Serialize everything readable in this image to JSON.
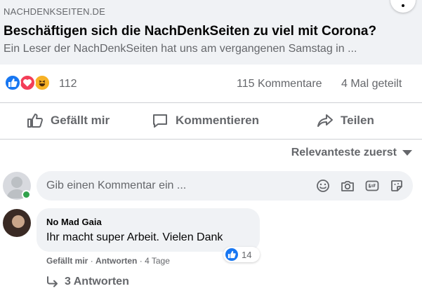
{
  "link_preview": {
    "domain": "NACHDENKSEITEN.DE",
    "title": "Beschäftigen sich die NachDenkSeiten zu viel mit Corona?",
    "description": "Ein Leser der NachDenkSeiten hat uns am vergangenen Samstag in ..."
  },
  "stats": {
    "reaction_icons": [
      "like-icon",
      "love-icon",
      "haha-icon"
    ],
    "reaction_count": "112",
    "comments": "115 Kommentare",
    "shares": "4 Mal geteilt"
  },
  "actions": {
    "like": "Gefällt mir",
    "comment": "Kommentieren",
    "share": "Teilen"
  },
  "sort": {
    "label": "Relevanteste zuerst"
  },
  "composer": {
    "placeholder": "Gib einen Kommentar ein ...",
    "icons": [
      "emoji-icon",
      "camera-icon",
      "gif-icon",
      "sticker-icon"
    ]
  },
  "comment": {
    "author": "No Mad Gaia",
    "text": "Ihr macht super Arbeit. Vielen Dank",
    "reaction_count": "14",
    "like_label": "Gefällt mir",
    "separator": "·",
    "reply_label": "Antworten",
    "time": "4 Tage",
    "replies_label": "3 Antworten"
  },
  "colors": {
    "brand_blue": "#1877f2",
    "secondary_text": "#65676b",
    "online_green": "#31a24c",
    "love_red": "#f33e58",
    "haha_yellow": "#f7b125"
  }
}
